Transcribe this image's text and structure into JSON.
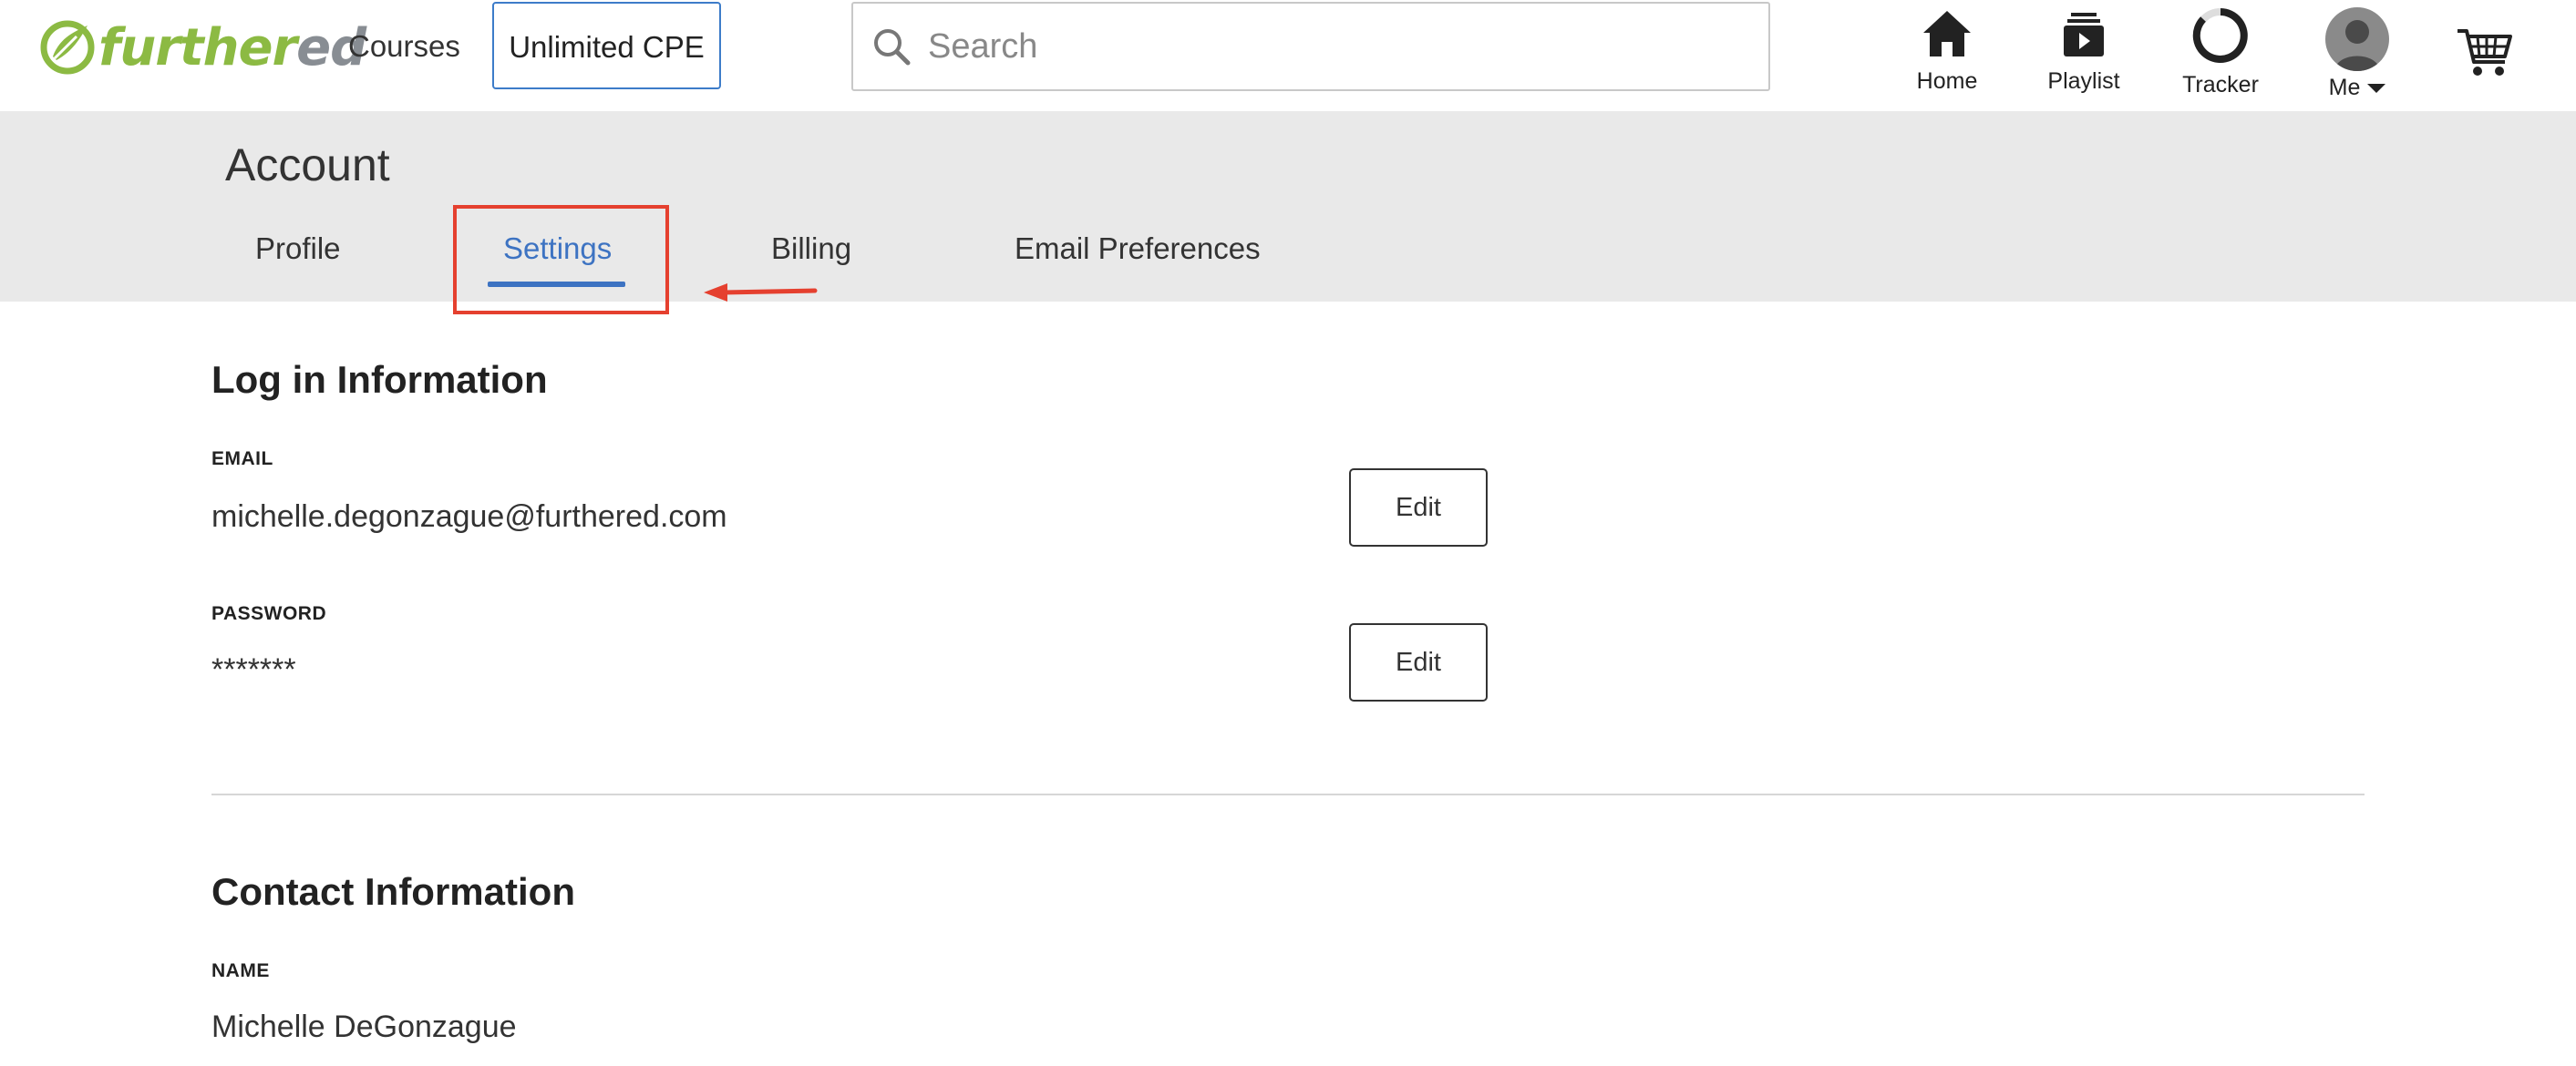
{
  "header": {
    "logo": {
      "text_main": "further",
      "text_accent": "ed"
    },
    "nav_links": {
      "courses": "Courses",
      "unlimited_cpe": "Unlimited CPE"
    },
    "search": {
      "placeholder": "Search",
      "value": ""
    },
    "icons": [
      {
        "name": "home-icon",
        "label": "Home"
      },
      {
        "name": "playlist-icon",
        "label": "Playlist"
      },
      {
        "name": "tracker-icon",
        "label": "Tracker"
      },
      {
        "name": "avatar",
        "label": "Me"
      }
    ],
    "cart_icon": "cart-icon"
  },
  "account": {
    "title": "Account",
    "tabs": [
      "Profile",
      "Settings",
      "Billing",
      "Email Preferences"
    ],
    "active_tab": "Settings"
  },
  "login_info": {
    "title": "Log in Information",
    "email_label": "EMAIL",
    "email_value": "michelle.degonzague@furthered.com",
    "password_label": "PASSWORD",
    "password_value": "*******",
    "edit_label": "Edit"
  },
  "contact_info": {
    "title": "Contact Information",
    "name_label": "NAME",
    "name_value": "Michelle DeGonzague"
  },
  "colors": {
    "brand_green": "#8cba43",
    "accent_blue": "#3d73c2",
    "annotation_red": "#e5402f",
    "band_gray": "#e9e9e9"
  }
}
